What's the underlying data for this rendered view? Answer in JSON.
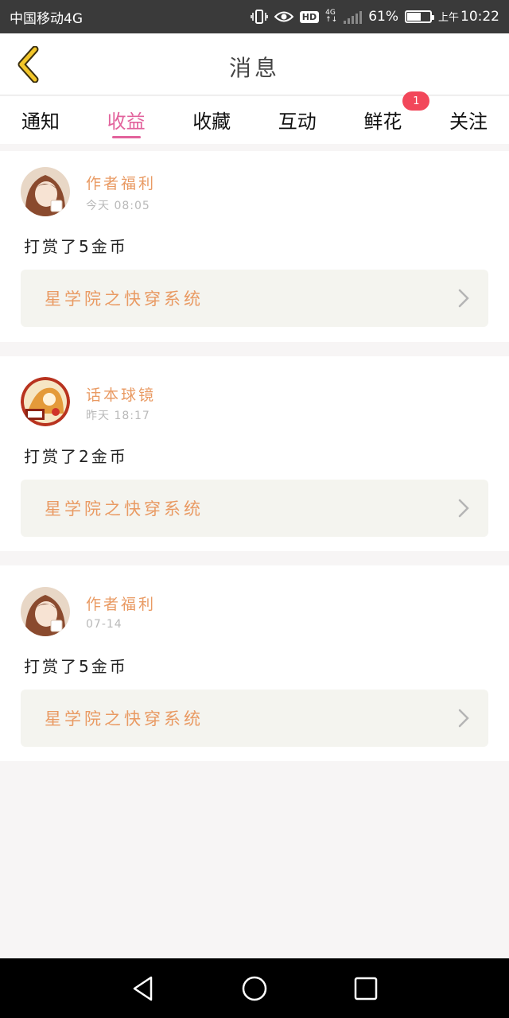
{
  "status_bar": {
    "carrier": "中国移动4G",
    "network_tag_top": "4G",
    "network_tag_bottom": "↑↓",
    "hd_label": "HD",
    "battery_pct": "61%",
    "battery_level": 0.61,
    "ampm": "上午",
    "time": "10:22"
  },
  "header": {
    "title": "消息",
    "back_icon": "chevron-left-icon",
    "accent_color": "#e6b800"
  },
  "tabs": [
    {
      "label": "通知",
      "active": false
    },
    {
      "label": "收益",
      "active": true
    },
    {
      "label": "收藏",
      "active": false
    },
    {
      "label": "互动",
      "active": false
    },
    {
      "label": "鲜花",
      "active": false,
      "badge": "1"
    },
    {
      "label": "关注",
      "active": false
    }
  ],
  "colors": {
    "tab_active": "#e2629c",
    "name_text": "#e99a63",
    "badge": "#f2475a",
    "link_bg": "#f4f4ef"
  },
  "cards": [
    {
      "name": "作者福利",
      "time": "今天 08:05",
      "message": "打赏了5金币",
      "book": "星学院之快穿系统",
      "avatar": "anime-girl-avatar"
    },
    {
      "name": "话本球镜",
      "time": "昨天 18:17",
      "message": "打赏了2金币",
      "book": "星学院之快穿系统",
      "avatar": "huaben-logo-avatar"
    },
    {
      "name": "作者福利",
      "time": "07-14",
      "message": "打赏了5金币",
      "book": "星学院之快穿系统",
      "avatar": "anime-girl-avatar"
    }
  ],
  "nav_bar": {
    "back": "triangle-back-icon",
    "home": "circle-home-icon",
    "recents": "square-recents-icon"
  }
}
